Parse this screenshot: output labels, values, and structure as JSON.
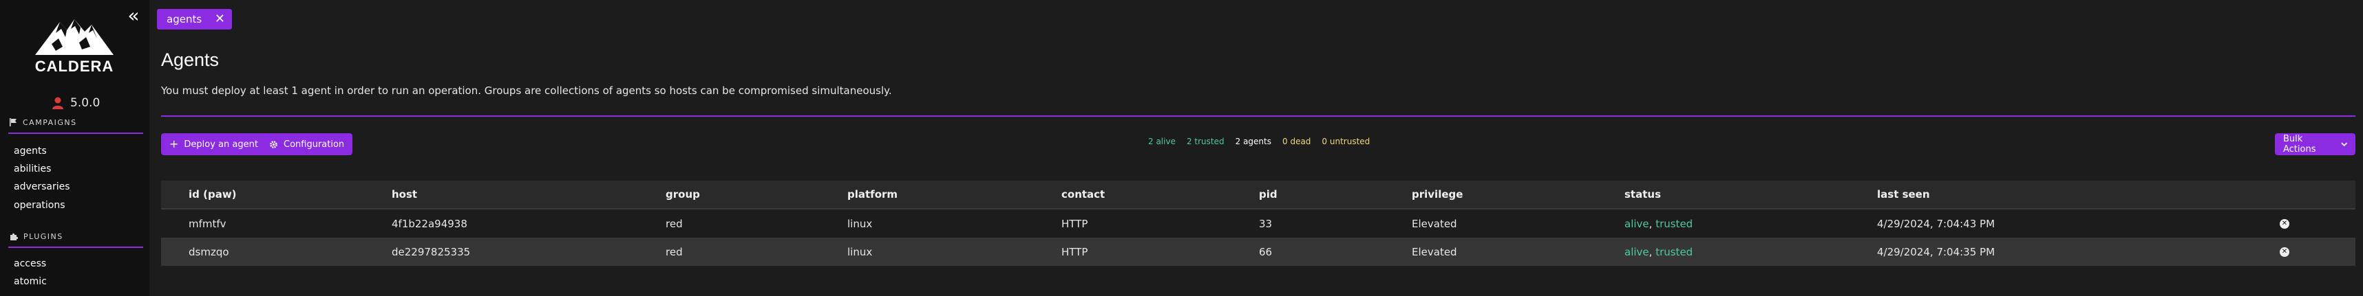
{
  "app": {
    "name": "CALDERA",
    "version": "5.0.0"
  },
  "sidebar": {
    "collapse_glyph": "«",
    "campaigns": {
      "title": "CAMPAIGNS",
      "items": [
        {
          "label": "agents"
        },
        {
          "label": "abilities"
        },
        {
          "label": "adversaries"
        },
        {
          "label": "operations"
        }
      ]
    },
    "plugins": {
      "title": "PLUGINS",
      "items": [
        {
          "label": "access"
        },
        {
          "label": "atomic"
        }
      ]
    }
  },
  "tab": {
    "label": "agents",
    "close_glyph": "✕"
  },
  "page": {
    "title": "Agents",
    "description": "You must deploy at least 1 agent in order to run an operation. Groups are collections of agents so hosts can be compromised simultaneously."
  },
  "toolbar": {
    "deploy_label": "Deploy an agent",
    "config_label": "Configuration",
    "bulk_label": "Bulk Actions"
  },
  "stats": {
    "alive": "2 alive",
    "trusted": "2 trusted",
    "total": "2 agents",
    "dead": "0 dead",
    "untrusted": "0 untrusted"
  },
  "table": {
    "headers": [
      "id (paw)",
      "host",
      "group",
      "platform",
      "contact",
      "pid",
      "privilege",
      "status",
      "last seen"
    ],
    "rows": [
      {
        "paw": "mfmtfv",
        "host": "4f1b22a94938",
        "group": "red",
        "platform": "linux",
        "contact": "HTTP",
        "pid": "33",
        "privilege": "Elevated",
        "status_alive": "alive",
        "status_sep": ", ",
        "status_trusted": "trusted",
        "last_seen": "4/29/2024, 7:04:43 PM"
      },
      {
        "paw": "dsmzqo",
        "host": "de2297825335",
        "group": "red",
        "platform": "linux",
        "contact": "HTTP",
        "pid": "66",
        "privilege": "Elevated",
        "status_alive": "alive",
        "status_sep": ", ",
        "status_trusted": "trusted",
        "last_seen": "4/29/2024, 7:04:35 PM"
      }
    ]
  },
  "colors": {
    "accent": "#8b2be2",
    "good": "#4ec9a0",
    "warn": "#f0d878",
    "danger": "#d93a3a"
  },
  "icons": [
    "collapse-icon",
    "caldera-mountain-logo",
    "user-icon",
    "flag-icon",
    "puzzle-icon",
    "close-icon",
    "plus-icon",
    "gear-icon",
    "chevron-down-icon",
    "delete-icon"
  ]
}
